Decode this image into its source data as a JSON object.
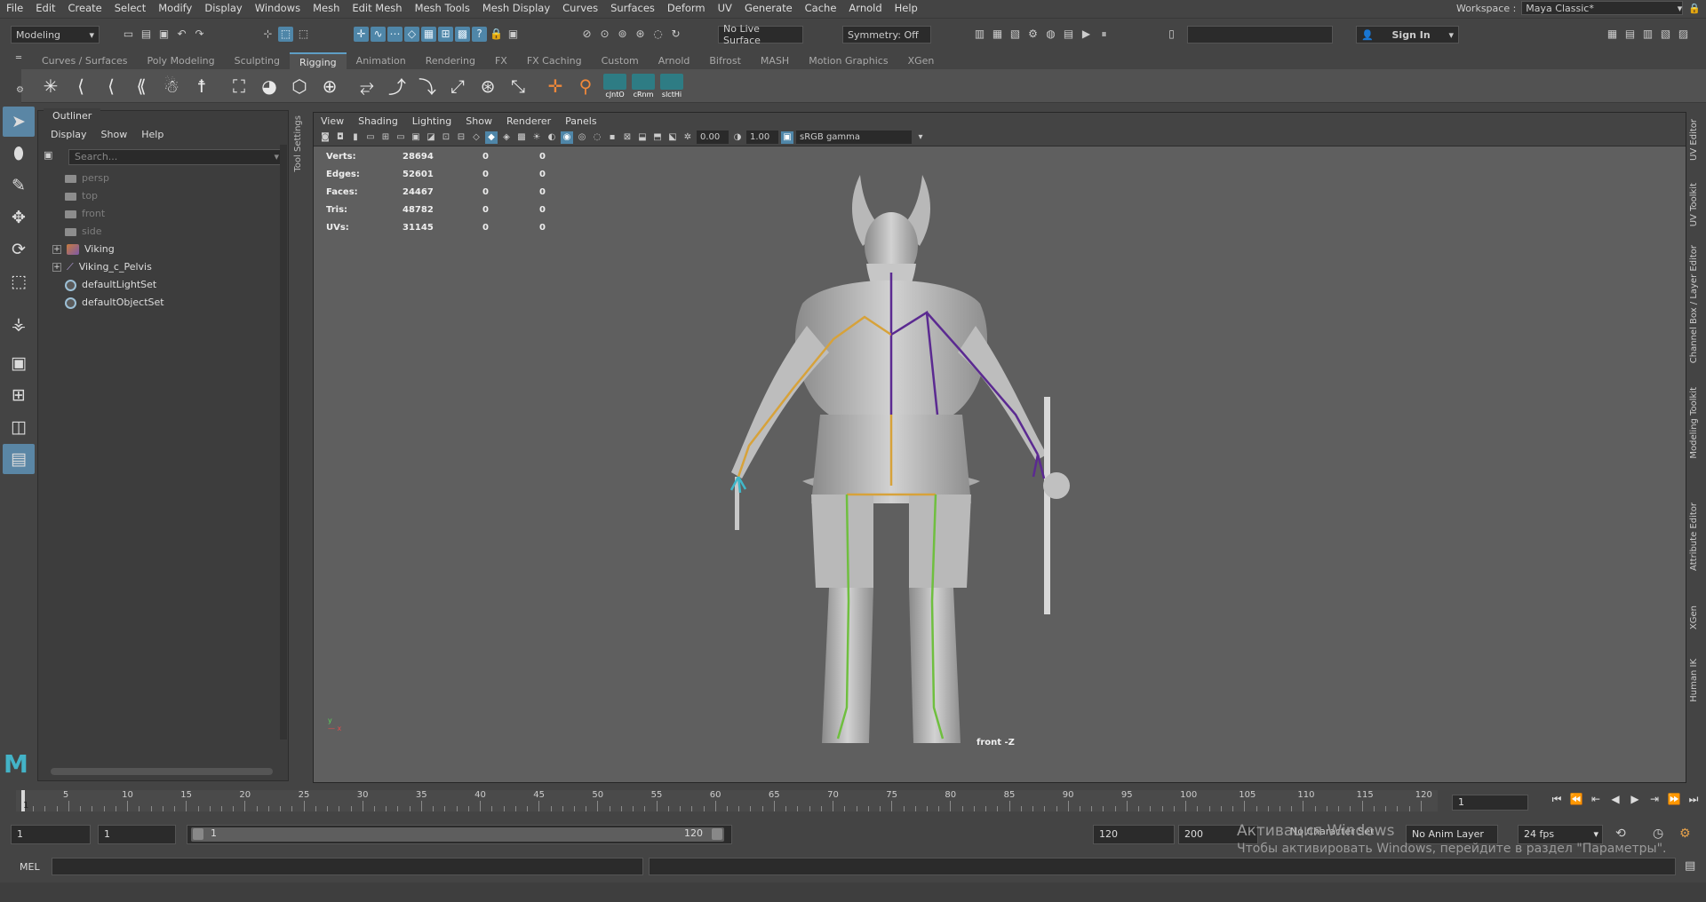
{
  "menubar": [
    "File",
    "Edit",
    "Create",
    "Select",
    "Modify",
    "Display",
    "Windows",
    "Mesh",
    "Edit Mesh",
    "Mesh Tools",
    "Mesh Display",
    "Curves",
    "Surfaces",
    "Deform",
    "UV",
    "Generate",
    "Cache",
    "Arnold",
    "Help"
  ],
  "workspace": {
    "label": "Workspace :",
    "value": "Maya Classic*"
  },
  "statusline": {
    "mode": "Modeling",
    "live_surface": "No Live Surface",
    "symmetry": "Symmetry: Off",
    "sign_in": "Sign In"
  },
  "shelf_tabs": [
    "Curves / Surfaces",
    "Poly Modeling",
    "Sculpting",
    "Rigging",
    "Animation",
    "Rendering",
    "FX",
    "FX Caching",
    "Custom",
    "Arnold",
    "Bifrost",
    "MASH",
    "Motion Graphics",
    "XGen"
  ],
  "active_shelf_tab": "Rigging",
  "shelf_buttons": {
    "btn1": "cJntO",
    "btn2": "cRnm",
    "btn3": "slctHi"
  },
  "outliner": {
    "title": "Outliner",
    "menu": [
      "Display",
      "Show",
      "Help"
    ],
    "search_placeholder": "Search...",
    "items": [
      {
        "label": "persp",
        "type": "camera"
      },
      {
        "label": "top",
        "type": "camera"
      },
      {
        "label": "front",
        "type": "camera"
      },
      {
        "label": "side",
        "type": "camera"
      },
      {
        "label": "Viking",
        "type": "mesh"
      },
      {
        "label": "Viking_c_Pelvis",
        "type": "joint"
      },
      {
        "label": "defaultLightSet",
        "type": "set"
      },
      {
        "label": "defaultObjectSet",
        "type": "set"
      }
    ]
  },
  "tool_settings_label": "Tool Settings",
  "viewport": {
    "menu": [
      "View",
      "Shading",
      "Lighting",
      "Show",
      "Renderer",
      "Panels"
    ],
    "exposure": "0.00",
    "gamma": "1.00",
    "color_space": "sRGB gamma",
    "camera_label": "front -Z",
    "hud": [
      {
        "label": "Verts:",
        "v1": "28694",
        "v2": "0",
        "v3": "0"
      },
      {
        "label": "Edges:",
        "v1": "52601",
        "v2": "0",
        "v3": "0"
      },
      {
        "label": "Faces:",
        "v1": "24467",
        "v2": "0",
        "v3": "0"
      },
      {
        "label": "Tris:",
        "v1": "48782",
        "v2": "0",
        "v3": "0"
      },
      {
        "label": "UVs:",
        "v1": "31145",
        "v2": "0",
        "v3": "0"
      }
    ]
  },
  "right_tabs": [
    "UV Editor",
    "UV Toolkit",
    "Channel Box / Layer Editor",
    "Modeling Toolkit",
    "Attribute Editor",
    "XGen",
    "Human IK"
  ],
  "timeline": {
    "ticks": [
      "5",
      "10",
      "15",
      "20",
      "25",
      "30",
      "35",
      "40",
      "45",
      "50",
      "55",
      "60",
      "65",
      "70",
      "75",
      "80",
      "85",
      "90",
      "95",
      "100",
      "105",
      "110",
      "115",
      "120"
    ],
    "current": "1",
    "current_field": "1"
  },
  "range": {
    "start": "1",
    "start_inner": "1",
    "slider_start": "1",
    "slider_end": "120",
    "end_inner": "120",
    "end": "200",
    "character_set": "No Character Set",
    "anim_layer": "No Anim Layer",
    "fps": "24 fps"
  },
  "cmdline": {
    "lang": "MEL"
  },
  "watermark": {
    "line1": "Активация Windows",
    "line2": "Чтобы активировать Windows, перейдите в раздел \"Параметры\"."
  }
}
